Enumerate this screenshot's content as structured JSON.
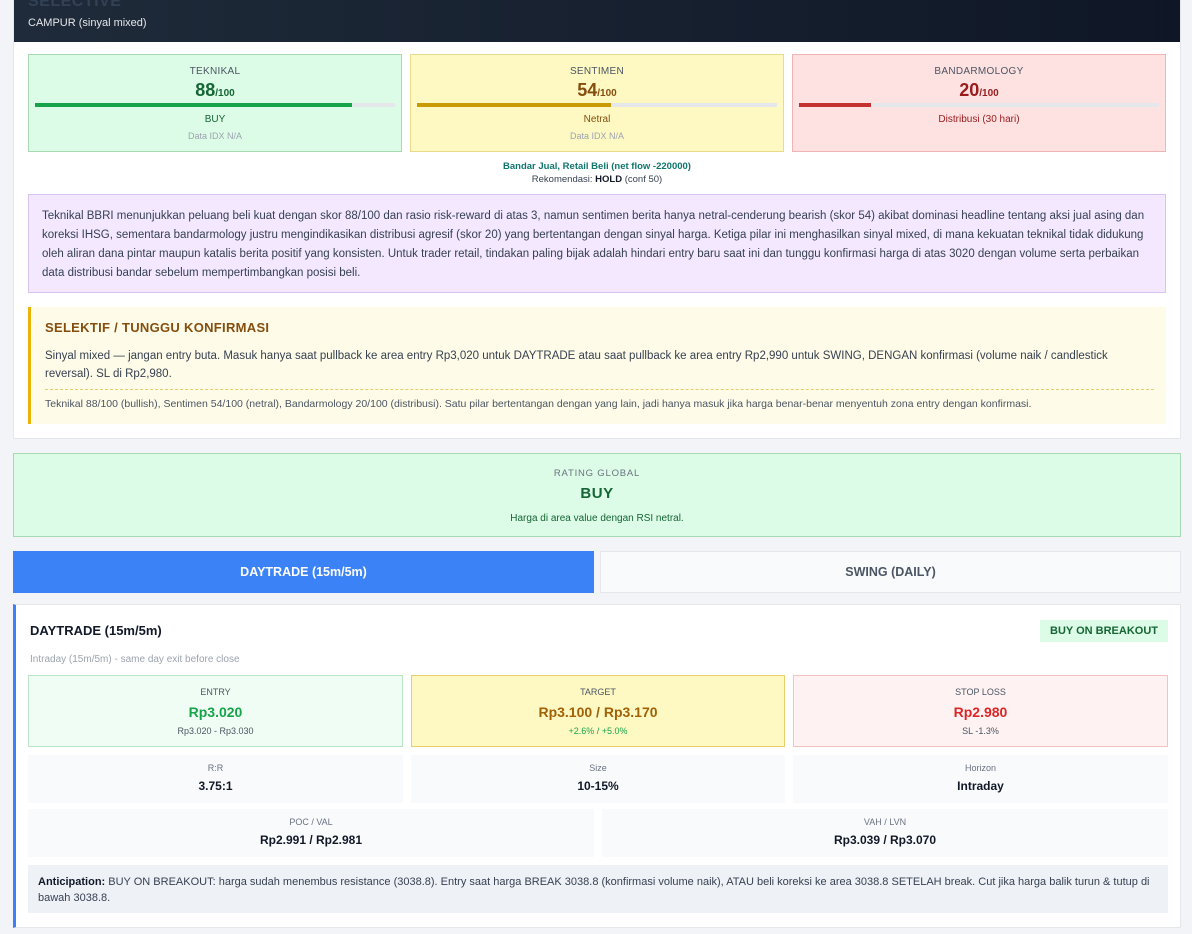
{
  "header": {
    "title": "SELECTIVE",
    "subtitle": "CAMPUR (sinyal mixed)"
  },
  "pillars": [
    {
      "label": "TEKNIKAL",
      "score": "88",
      "max": "/100",
      "fill": 0.88,
      "verdict": "BUY",
      "note": "Data IDX N/A"
    },
    {
      "label": "SENTIMEN",
      "score": "54",
      "max": "/100",
      "fill": 0.54,
      "verdict": "Netral",
      "note": "Data IDX N/A"
    },
    {
      "label": "BANDARMOLOGY",
      "score": "20",
      "max": "/100",
      "fill": 0.2,
      "verdict": "Distribusi (30 hari)",
      "note": ""
    }
  ],
  "flow": "Bandar Jual, Retail Beli (net flow -220000)",
  "recommendation": {
    "prefix": "Rekomendasi: ",
    "action": "HOLD",
    "suffix": " (conf 50)"
  },
  "summary": "Teknikal BBRI menunjukkan peluang beli kuat dengan skor 88/100 dan rasio risk-reward di atas 3, namun sentimen berita hanya netral-cenderung bearish (skor 54) akibat dominasi headline tentang aksi jual asing dan koreksi IHSG, sementara bandarmology justru mengindikasikan distribusi agresif (skor 20) yang bertentangan dengan sinyal harga. Ketiga pilar ini menghasilkan sinyal mixed, di mana kekuatan teknikal tidak didukung oleh aliran dana pintar maupun katalis berita positif yang konsisten. Untuk trader retail, tindakan paling bijak adalah hindari entry baru saat ini dan tunggu konfirmasi harga di atas 3020 dengan volume serta perbaikan data distribusi bandar sebelum mempertimbangkan posisi beli.",
  "advice": {
    "title": "SELEKTIF / TUNGGU KONFIRMASI",
    "body": "Sinyal mixed — jangan entry buta. Masuk hanya saat pullback ke area entry Rp3,020 untuk DAYTRADE atau saat pullback ke area entry Rp2,990 untuk SWING, DENGAN konfirmasi (volume naik / candlestick reversal). SL di Rp2,980.",
    "footer": "Teknikal 88/100 (bullish), Sentimen 54/100 (netral), Bandarmology 20/100 (distribusi). Satu pilar bertentangan dengan yang lain, jadi hanya masuk jika harga benar-benar menyentuh zona entry dengan konfirmasi."
  },
  "rating": {
    "label": "RATING GLOBAL",
    "value": "BUY",
    "description": "Harga di area value dengan RSI netral."
  },
  "tabs": [
    {
      "label": "DAYTRADE (15m/5m)",
      "active": true
    },
    {
      "label": "SWING (DAILY)",
      "active": false
    }
  ],
  "daytrade": {
    "title": "DAYTRADE (15m/5m)",
    "badge": "BUY ON BREAKOUT",
    "subtitle": "Intraday (15m/5m) - same day exit before close",
    "entry": {
      "label": "ENTRY",
      "value": "Rp3.020",
      "sub": "Rp3.020 - Rp3.030"
    },
    "target": {
      "label": "TARGET",
      "value": "Rp3.100 / Rp3.170",
      "sub": "+2.6% / +5.0%"
    },
    "stop": {
      "label": "STOP LOSS",
      "value": "Rp2.980",
      "sub": "SL -1.3%"
    },
    "metrics": [
      {
        "label": "R:R",
        "value": "3.75:1"
      },
      {
        "label": "Size",
        "value": "10-15%"
      },
      {
        "label": "Horizon",
        "value": "Intraday"
      }
    ],
    "profile": [
      {
        "label": "POC / VAL",
        "value": "Rp2.991 / Rp2.981"
      },
      {
        "label": "VAH / LVN",
        "value": "Rp3.039 / Rp3.070"
      }
    ],
    "anticipation_label": "Anticipation:",
    "anticipation": " BUY ON BREAKOUT: harga sudah menembus resistance (3038.8). Entry saat harga BREAK 3038.8 (konfirmasi volume naik), ATAU beli koreksi ke area 3038.8 SETELAH break. Cut jika harga balik turun & tutup di bawah 3038.8."
  },
  "colors": {
    "accent": "#3b82f6",
    "buy": "#16a34a",
    "neutral": "#ca9a04",
    "sell": "#c53030"
  }
}
